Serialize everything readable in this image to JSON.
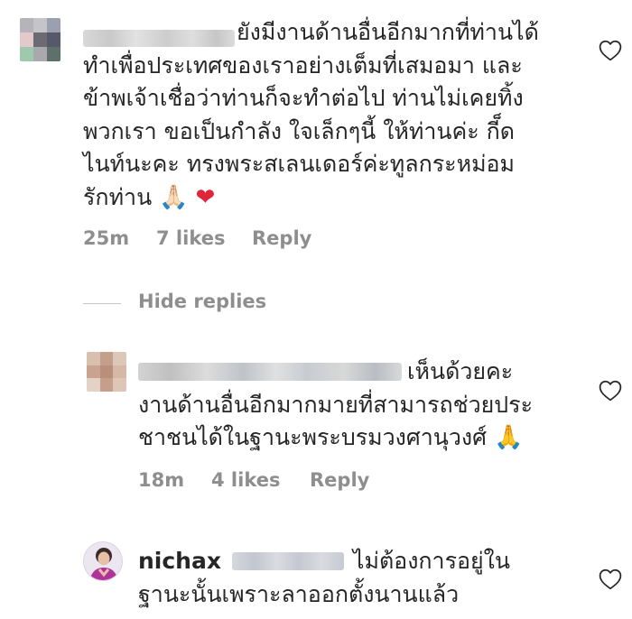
{
  "comment1": {
    "text_lines": [
      "ยังมีงานด้านอื่นอีกมากที่ท่านได้",
      "ทำเพื่อประเทศของเราอย่างเต็มที่เสมอมา และ",
      "ข้าพเจ้าเชื่อว่าท่านก็จะทำต่อไป ท่านไม่เคยทิ้ง",
      "พวกเรา ขอเป็นกำลัง ใจเล็กๆนี้ ให้ท่านค่ะ กี็ด",
      "ไนท์นะคะ ทรงพระสเลนเดอร์ค่ะทูลกระหม่อม",
      "รักท่าน"
    ],
    "emojis": [
      "🙏🏻",
      "❤"
    ],
    "time": "25m",
    "likes": "7 likes",
    "reply": "Reply"
  },
  "hide_replies": "Hide replies",
  "reply1": {
    "text_lines": [
      "เห็นด้วยคะ",
      "งานด้านอื่นอีกมากมายที่สามารถช่วยประ",
      "ชาชนได้ในฐานะพระบรมวงศานุวงศ์"
    ],
    "emoji": "🙏",
    "time": "18m",
    "likes": "4 likes",
    "reply": "Reply"
  },
  "reply2": {
    "username": "nichax",
    "text_lines": [
      "ไม่ต้องการอยู่ใน",
      "ฐานะนั้นเพราะลาออกตั้งนานแล้ว"
    ]
  },
  "colors": {
    "text": "#262626",
    "meta": "#8e8e8e",
    "heart_emoji": "#e0243a",
    "divider": "#c7c7c7"
  },
  "icons": [
    "heart-outline-icon",
    "folded-hands-emoji",
    "red-heart-emoji"
  ]
}
